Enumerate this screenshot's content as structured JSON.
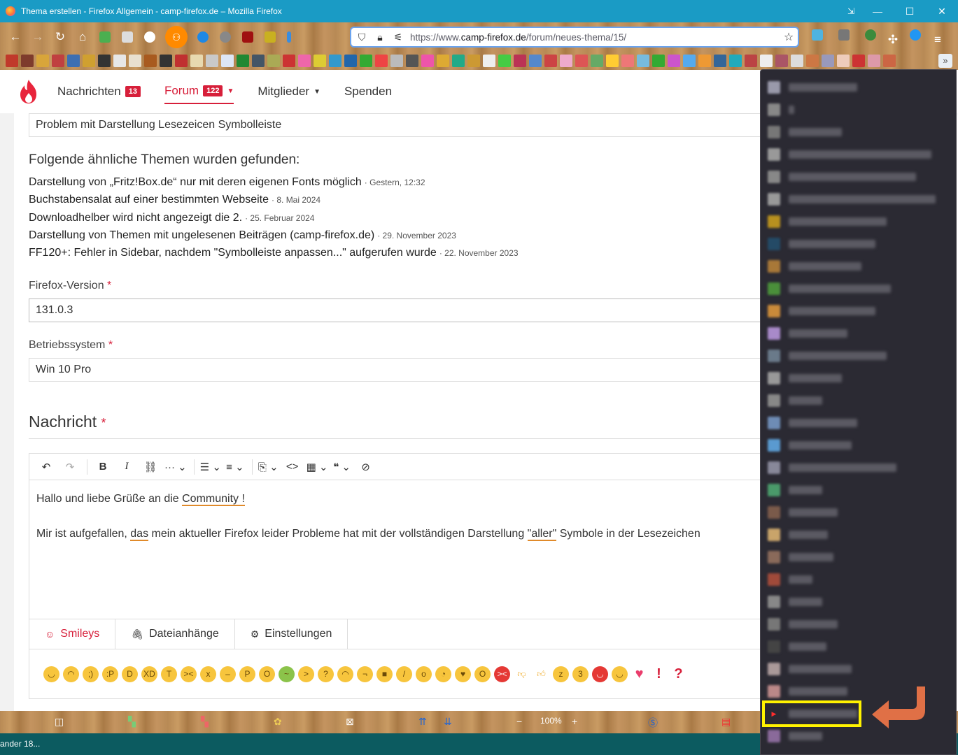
{
  "window": {
    "title": "Thema erstellen - Firefox Allgemein - camp-firefox.de – Mozilla Firefox"
  },
  "url": {
    "prefix": "https://www.",
    "domain": "camp-firefox.de",
    "path": "/forum/neues-thema/15/"
  },
  "nav": {
    "items": [
      {
        "label": "Nachrichten",
        "badge": "13"
      },
      {
        "label": "Forum",
        "badge": "122"
      },
      {
        "label": "Mitglieder"
      },
      {
        "label": "Spenden"
      }
    ]
  },
  "form": {
    "subject_value": "Problem mit Darstellung Lesezeicen Symbolleiste",
    "similar_heading": "Folgende ähnliche Themen wurden gefunden:",
    "similar": [
      {
        "title": "Darstellung von „Fritz!Box.de“ nur mit deren eigenen Fonts möglich",
        "date": "· Gestern, 12:32"
      },
      {
        "title": "Buchstabensalat auf einer bestimmten Webseite",
        "date": "· 8. Mai 2024"
      },
      {
        "title": "Downloadhelber wird nicht angezeigt die 2.",
        "date": "· 25. Februar 2024"
      },
      {
        "title": "Darstellung von Themen mit ungelesenen Beiträgen (camp-firefox.de)",
        "date": "· 29. November 2023"
      },
      {
        "title": "FF120+: Fehler in Sidebar, nachdem \"Symbolleiste anpassen...\" aufgerufen wurde",
        "date": "· 22. November 2023"
      }
    ],
    "version_label": "Firefox-Version",
    "version_value": "131.0.3",
    "os_label": "Betriebssystem",
    "os_value": "Win 10 Pro",
    "message_heading": "Nachricht",
    "required_mark": "*"
  },
  "editor": {
    "line1_a": "Hallo und liebe Grüße an die ",
    "line1_b": "Community !",
    "line2_a": "Mir ist aufgefallen, ",
    "line2_b": "das",
    "line2_c": " mein aktueller Firefox leider Probleme hat mit der vollständigen Darstellung ",
    "line2_d": "\"aller\"",
    "line2_e": " Symbole in der Lesezeichen"
  },
  "tabs": [
    {
      "label": "Smileys",
      "icon": "smiley-icon"
    },
    {
      "label": "Dateianhänge",
      "icon": "paperclip-icon"
    },
    {
      "label": "Einstellungen",
      "icon": "gear-icon"
    }
  ],
  "bottom": {
    "zoom": "100%"
  },
  "taskbar": {
    "item": "ander 18..."
  },
  "colors": {
    "accent": "#d71f3a",
    "titlebar": "#1a9bc5",
    "popup_bg": "#2b2a33",
    "highlight": "#fff200",
    "arrow": "#e07046"
  }
}
